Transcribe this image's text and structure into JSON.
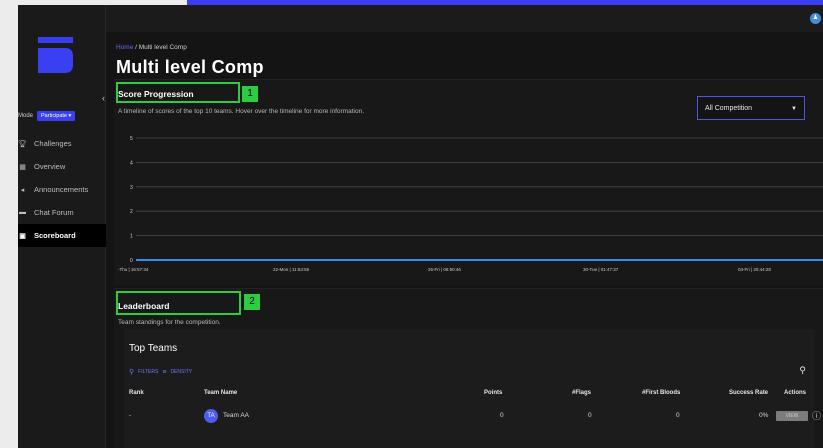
{
  "app": {
    "accent_color": "#3b3ff2",
    "highlight_color": "#2ecc40"
  },
  "sidebar": {
    "mode_label": "Mode",
    "mode_value": "Participate",
    "items": [
      {
        "label": "Challenges",
        "icon": "trophy-icon",
        "active": false
      },
      {
        "label": "Overview",
        "icon": "dashboard-icon",
        "active": false
      },
      {
        "label": "Announcements",
        "icon": "megaphone-icon",
        "active": false
      },
      {
        "label": "Chat Forum",
        "icon": "chat-icon",
        "active": false
      },
      {
        "label": "Scoreboard",
        "icon": "scoreboard-icon",
        "active": true
      }
    ]
  },
  "breadcrumb": {
    "home": "Home",
    "separator": " / ",
    "current": "Multi level Comp"
  },
  "page_title": "Multi level Comp",
  "score_progression": {
    "title": "Score Progression",
    "subtitle": "A timeline of scores of the top 10 teams. Hover over the timeline for more information.",
    "marker": "1",
    "select_value": "All Competition"
  },
  "chart_data": {
    "type": "line",
    "title": "",
    "xlabel": "",
    "ylabel": "",
    "ylim": [
      0,
      5
    ],
    "y_ticks": [
      "0",
      "1",
      "2",
      "3",
      "4",
      "5"
    ],
    "x_ticks": [
      "-Thu | 16:57:34",
      "22-Mon | 11:53:55",
      "26-Fri | 06:50:46",
      "30-Tue | 01:47:37",
      "03-Fri | 20:44:28"
    ],
    "series": [
      {
        "color": "#2f8ff0",
        "values": [
          0,
          0,
          0,
          0,
          0
        ]
      }
    ],
    "grid": true
  },
  "leaderboard": {
    "title": "Leaderboard",
    "subtitle": "Team standings for the competition.",
    "marker": "2",
    "card_title": "Top Teams",
    "filters_label": "FILTERS",
    "density_label": "DENSITY",
    "columns": [
      "Rank",
      "Team Name",
      "Points",
      "#Flags",
      "#First Bloods",
      "Success Rate",
      "Actions"
    ],
    "rows": [
      {
        "rank": "-",
        "initials": "TA",
        "team": "Team AA",
        "points": "0",
        "flags": "0",
        "first_bloods": "0",
        "success_rate": "0%",
        "action": "VIEW"
      }
    ]
  }
}
